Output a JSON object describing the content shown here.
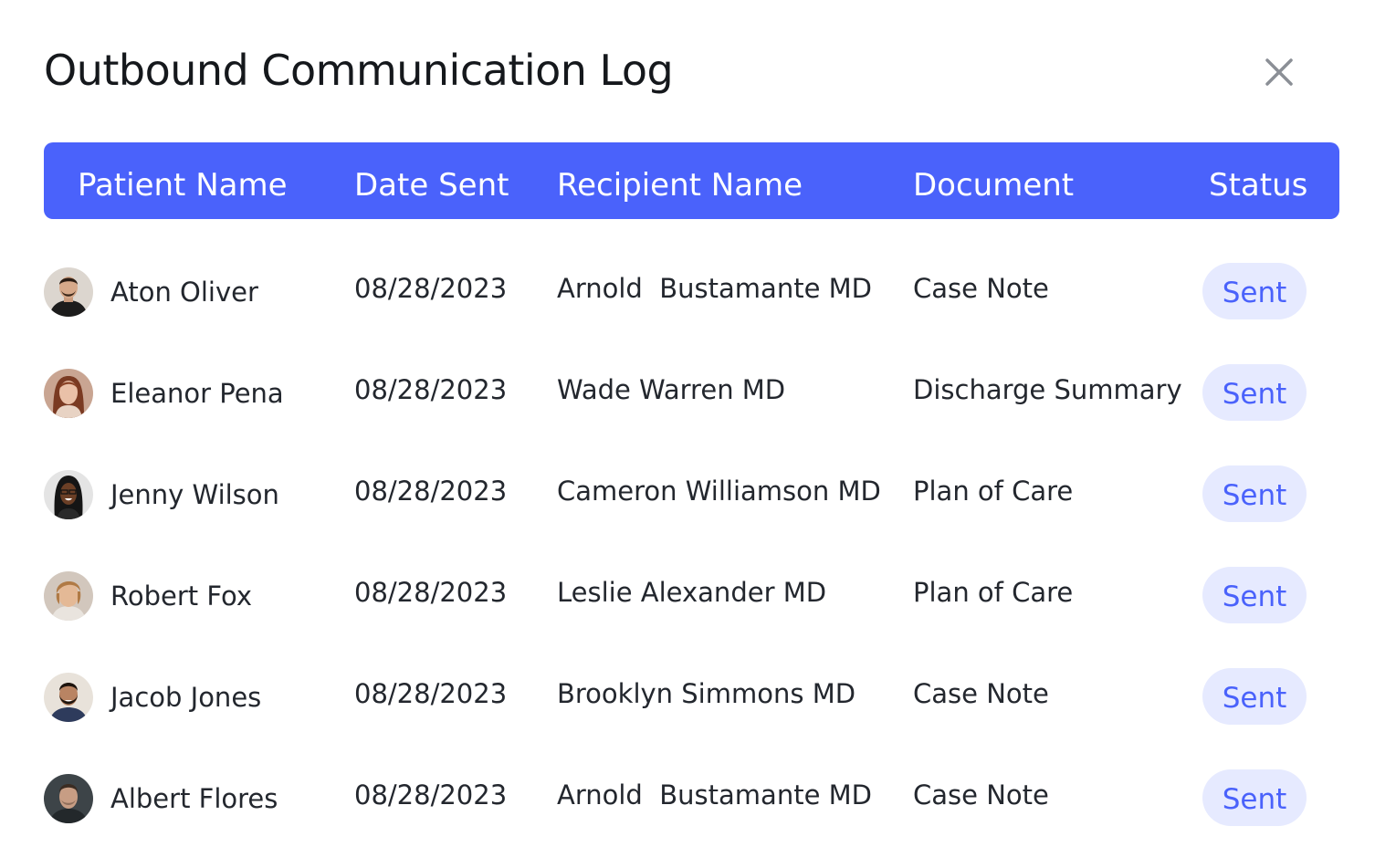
{
  "dialog": {
    "title": "Outbound Communication Log",
    "close_icon": "close-icon"
  },
  "colors": {
    "header_bg": "#4a62fb",
    "header_text": "#ffffff",
    "badge_bg": "#e6eaff",
    "badge_text": "#4a62fb"
  },
  "table": {
    "columns": [
      "Patient Name",
      "Date Sent",
      "Recipient Name",
      "Document",
      "Status"
    ],
    "rows": [
      {
        "patient": "Aton Oliver",
        "date": "08/28/2023",
        "recipient": "Arnold  Bustamante MD",
        "document": "Case Note",
        "status": "Sent"
      },
      {
        "patient": "Eleanor Pena",
        "date": "08/28/2023",
        "recipient": "Wade Warren MD",
        "document": "Discharge Summary",
        "status": "Sent"
      },
      {
        "patient": "Jenny Wilson",
        "date": "08/28/2023",
        "recipient": "Cameron Williamson MD",
        "document": "Plan of Care",
        "status": "Sent"
      },
      {
        "patient": "Robert Fox",
        "date": "08/28/2023",
        "recipient": "Leslie Alexander MD",
        "document": "Plan of Care",
        "status": "Sent"
      },
      {
        "patient": "Jacob Jones",
        "date": "08/28/2023",
        "recipient": "Brooklyn Simmons MD",
        "document": "Case Note",
        "status": "Sent"
      },
      {
        "patient": "Albert Flores",
        "date": "08/28/2023",
        "recipient": "Arnold  Bustamante MD",
        "document": "Case Note",
        "status": "Sent"
      }
    ]
  }
}
